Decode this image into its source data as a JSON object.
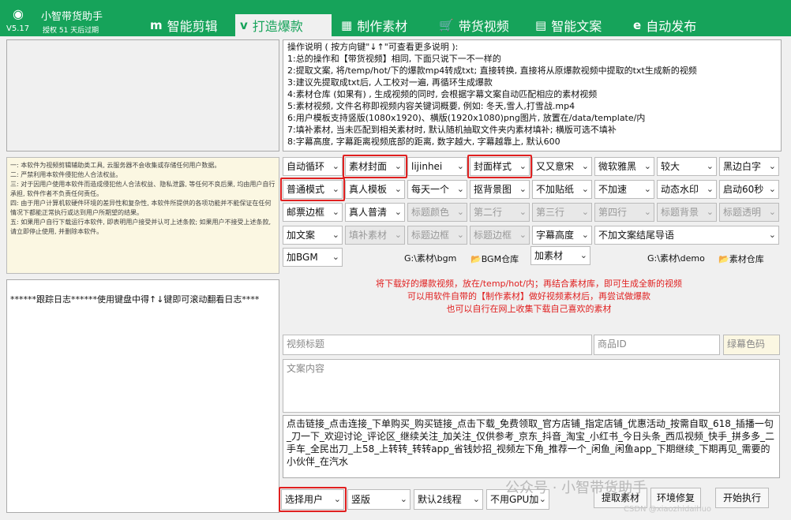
{
  "app": {
    "name": "小智带货助手",
    "version": "V5.17",
    "license": "授权 51 天后过期",
    "logo": "robot-icon"
  },
  "tabs": [
    {
      "icon": "m",
      "label": "智能剪辑"
    },
    {
      "icon": "v",
      "label": "打造爆款"
    },
    {
      "icon": "▦",
      "label": "制作素材"
    },
    {
      "icon": "🛒",
      "label": "带货视频"
    },
    {
      "icon": "▤",
      "label": "智能文案"
    },
    {
      "icon": "e",
      "label": "自动发布"
    }
  ],
  "notice": "一: 本软件为视频剪辑辅助类工具, 云服务器不会收集或存储任何用户数据。\n二: 严禁利用本软件侵犯他人合法权益。\n三: 对于因用户使用本软件而造成侵犯他人合法权益、隐私泄露, 等任何不良后果, 均由用户自行承担, 软件作者不负责任何责任。\n四: 由于用户计算机软硬件环境的差异性和复杂性, 本软件所提供的各项功能并不能保证在任何情况下都能正常执行或达到用户所期望的结果。\n五: 如果用户自行下载运行本软件, 即表明用户接受并认可上述条款; 如果用户不接受上述条款, 请立即停止使用, 并删除本软件。",
  "log": "******跟踪日志******使用键盘中得↑↓键即可滚动翻看日志****",
  "instructions": "操作说明 ( 按方向键\"↓↑\"可查看更多说明 ):\n1:总的操作和【带货视频】相同, 下面只说下一不一样的\n2:提取文案, 将/temp/hot/下的爆款mp4转成txt; 直接转换, 直接将从原爆款视频中提取的txt生成新的视频\n3:建议先提取成txt后, 人工校对一遍, 再循环生成爆款\n4:素材仓库 (如果有) , 生成视频的同时, 会根据字幕文案自动匹配相应的素材视频\n5:素材视频, 文件名称即视频内容关键词概要, 例如: 冬天,雪人,打雪战.mp4\n6:用户模板支持竖版(1080x1920)、横版(1920x1080)png图片, 放置在/data/template/内\n7:填补素材, 当未匹配到相关素材时, 默认随机抽取文件夹内素材填补; 横版可选不填补\n8:字幕高度, 字幕距离视频底部的距离, 数字越大, 字幕越靠上, 默认600",
  "row1": [
    "自动循环",
    "素材封面",
    "lijinhei",
    "封面样式",
    "又又意宋",
    "微软雅黑",
    "较大",
    "黑边白字"
  ],
  "row2": [
    "普通模式",
    "真人模板",
    "每天一个",
    "抠背景图",
    "不加贴纸",
    "不加速",
    "动态水印",
    "启动60秒"
  ],
  "row3": [
    "邮票边框",
    "真人普清",
    "标题颜色",
    "第二行",
    "第三行",
    "第四行",
    "标题背景",
    "标题透明"
  ],
  "row4": [
    "加文案",
    "填补素材",
    "标题边框",
    "标题边框",
    "字幕高度",
    "不加文案结尾导语"
  ],
  "bgm": {
    "dd": "加BGM",
    "path": "G:\\素材\\bgm",
    "button": "BGM仓库"
  },
  "material": {
    "dd": "加素材",
    "path": "G:\\素材\\demo",
    "button": "素材仓库"
  },
  "hint": [
    "将下载好的爆款视频，放在/temp/hot/内；再结合素材库，即可生成全新的视频",
    "可以用软件自带的【制作素材】做好视频素材后，再尝试做爆款",
    "也可以自行在网上收集下载自己喜欢的素材"
  ],
  "fields": {
    "video_title": "视频标题",
    "product_id": "商品ID",
    "green_color": "绿幕色码",
    "content": "文案内容"
  },
  "tags": "点击链接_点击连接_下单购买_购买链接_点击下载_免费领取_官方店铺_指定店铺_优惠活动_按需自取_618_插播一句_刀一下_欢迎讨论_评论区_继续关注_加关注_仅供参考_京东_抖音_淘宝_小红书_今日头条_西瓜视频_快手_拼多多_二手车_全民出刀_上58_上转转_转转app_省钱妙招_视频左下角_推荐一个_闲鱼_闲鱼app_下期继续_下期再见_需要的小伙伴_在汽水",
  "bottom": {
    "user": "选择用户",
    "orient": "竖版",
    "threads": "默认2线程",
    "gpu": "不用GPU加",
    "extract": "提取素材",
    "repair": "环境修复",
    "start": "开始执行"
  },
  "watermark": {
    "main": "公众号 · 小智带货助手",
    "sub": "CSDN @xiaozhidaihuo"
  },
  "colors": {
    "brand": "#16a35a",
    "highlight": "#e02020",
    "hint": "#e02020"
  }
}
